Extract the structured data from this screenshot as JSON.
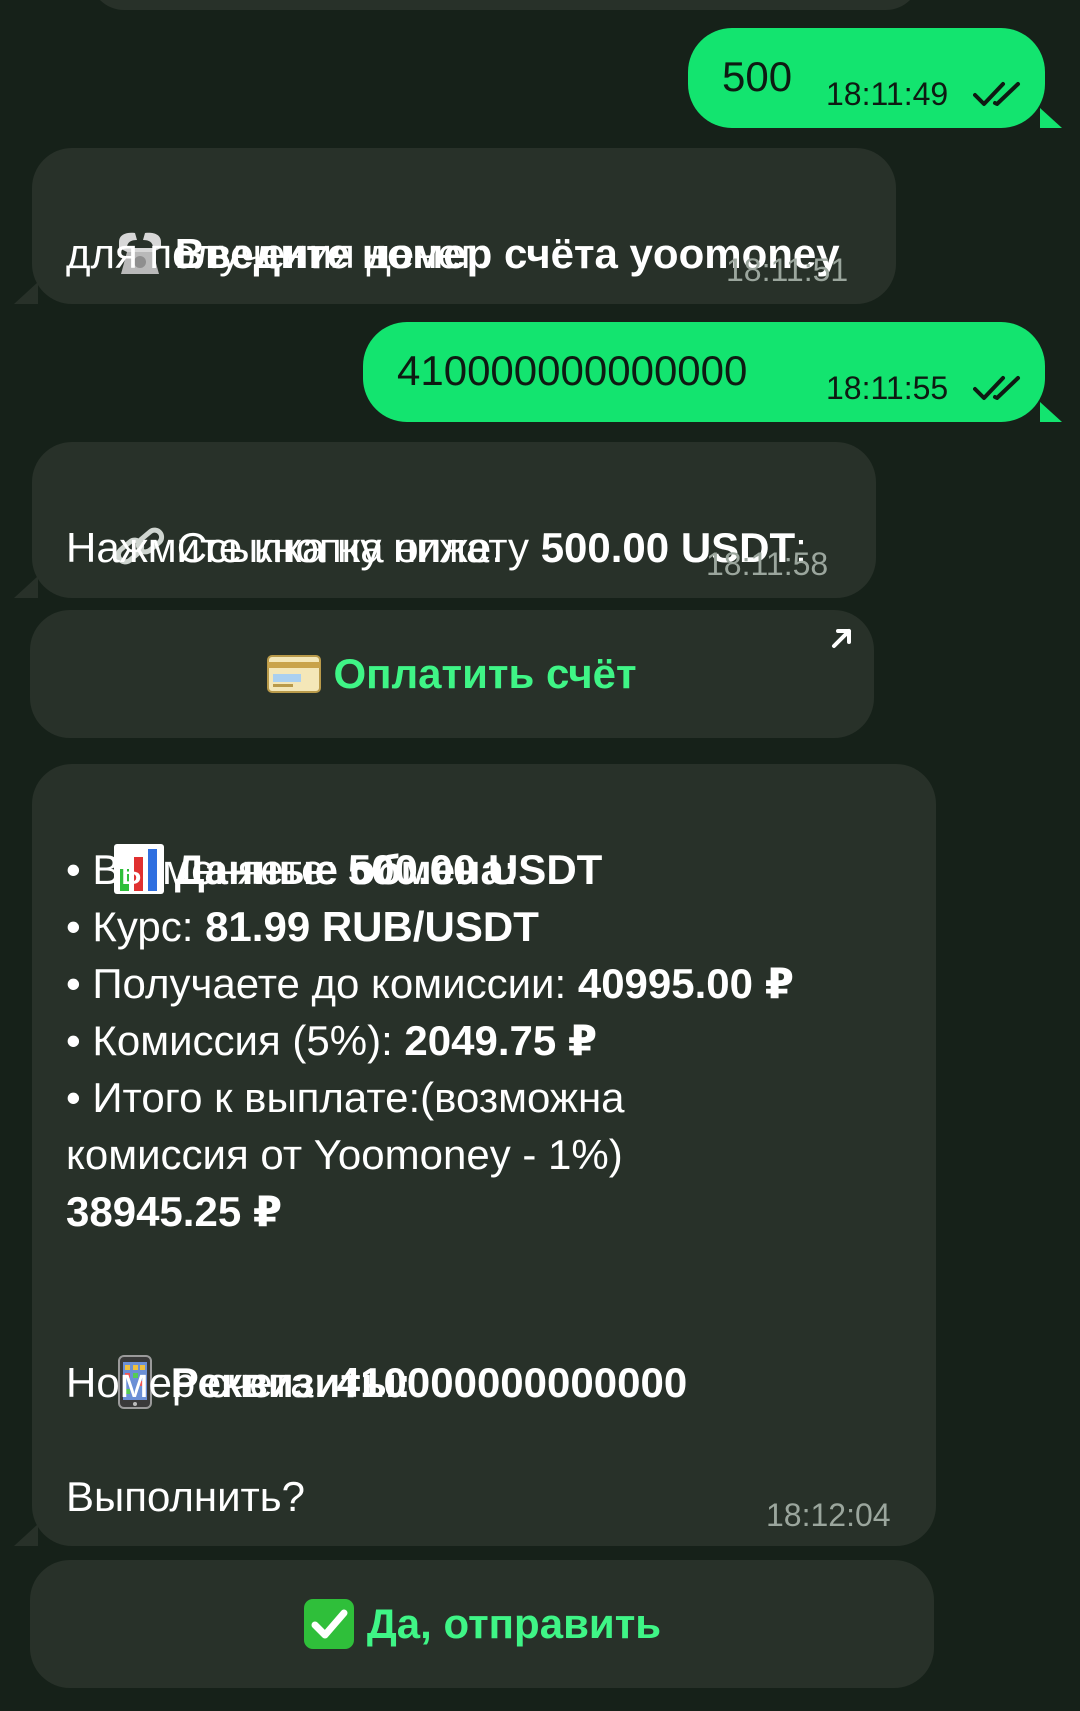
{
  "messages": [
    {
      "id": "m1",
      "type": "outgoing",
      "text": "500",
      "time": "18:11:49"
    },
    {
      "id": "m2",
      "type": "incoming",
      "icon": "phone-icon",
      "bold_text": "Введите номер счёта yoomoney",
      "text": "для получения денег:",
      "time": "18:11:51"
    },
    {
      "id": "m3",
      "type": "outgoing",
      "text": "410000000000000",
      "time": "18:11:55"
    },
    {
      "id": "m4",
      "type": "incoming",
      "icon": "link-icon",
      "prefix": "Ссылка на оплату ",
      "bold_amount": "500.00 USDT",
      "suffix": ":",
      "line2": "Нажмите кнопку ниже.",
      "time": "18:11:58"
    },
    {
      "id": "m5",
      "type": "incoming",
      "icon": "bar-chart-icon",
      "title": "Данные обмена:",
      "rows": [
        {
          "label": "• Вы меняете: ",
          "value": "500.00 USDT"
        },
        {
          "label": "• Курс: ",
          "value": "81.99 RUB/USDT"
        },
        {
          "label": "• Получаете до комиссии: ",
          "value": "40995.00 ₽"
        },
        {
          "label": "• Комиссия (5%): ",
          "value": "2049.75 ₽"
        }
      ],
      "total_line1": "• Итого к выплате:(возможна",
      "total_line2": "комиссия от Yoomoney - 1%)",
      "total_value": "38945.25 ₽",
      "req_icon": "mobile-phone-icon",
      "req_title": "Реквизиты:",
      "req_label": "Номер счета: ",
      "req_value": "410000000000000",
      "question": "Выполнить?",
      "time": "18:12:04"
    }
  ],
  "buttons": {
    "pay": {
      "icon": "credit-card-icon",
      "label": "Оплатить счёт"
    },
    "confirm": {
      "icon": "check-mark-icon",
      "label": "Да, отправить"
    }
  },
  "colors": {
    "background": "#162119",
    "outgoing_bubble": "#13e46f",
    "incoming_bubble": "#283129",
    "button_text": "#3ff586"
  }
}
